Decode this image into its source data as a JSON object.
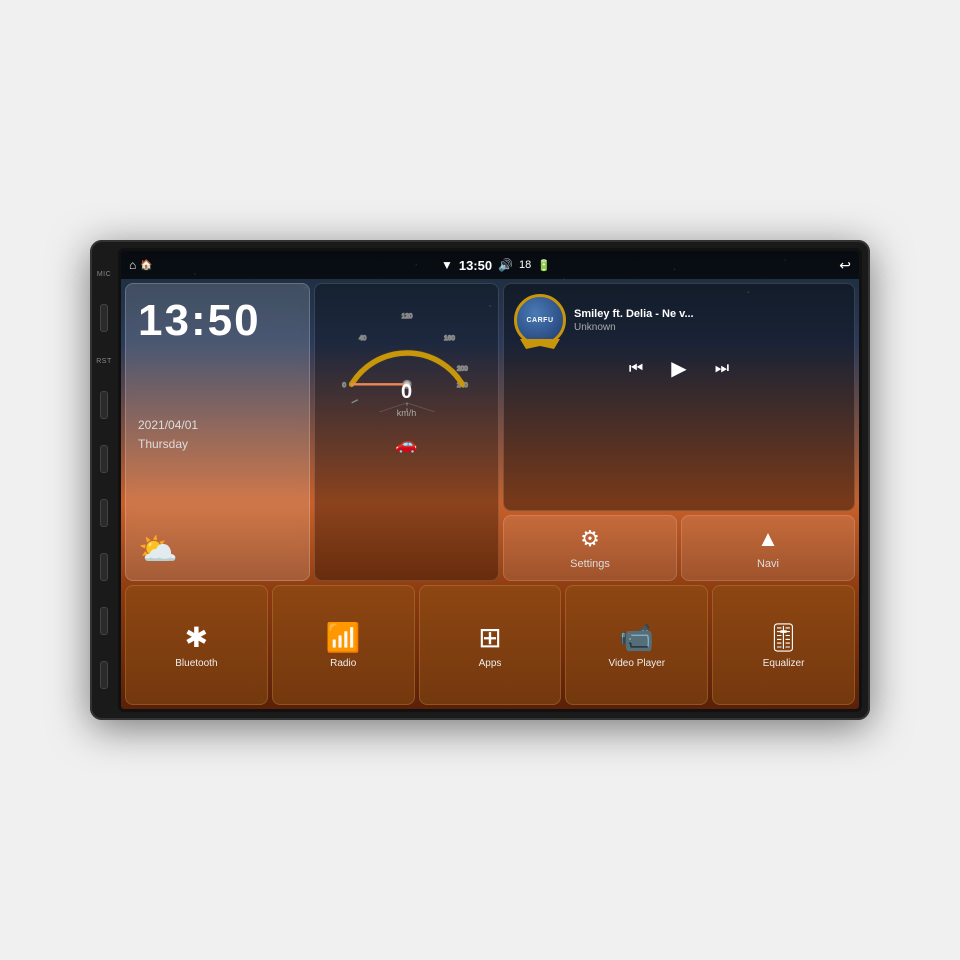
{
  "stereo": {
    "shell_label": "Car Stereo Unit"
  },
  "status_bar": {
    "time": "13:50",
    "volume": "18",
    "wifi_icon": "▼",
    "back_icon": "↩"
  },
  "clock": {
    "time": "13:50",
    "date": "2021/04/01",
    "day": "Thursday"
  },
  "music": {
    "title": "Smiley ft. Delia - Ne v...",
    "artist": "Unknown",
    "album_label": "CARFU"
  },
  "speed": {
    "value": "0",
    "unit": "km/h"
  },
  "buttons": {
    "settings": "Settings",
    "navi": "Navi",
    "bluetooth": "Bluetooth",
    "radio": "Radio",
    "apps": "Apps",
    "video_player": "Video Player",
    "equalizer": "Equalizer"
  },
  "side_labels": {
    "mic": "MIC",
    "rst": "RST"
  }
}
